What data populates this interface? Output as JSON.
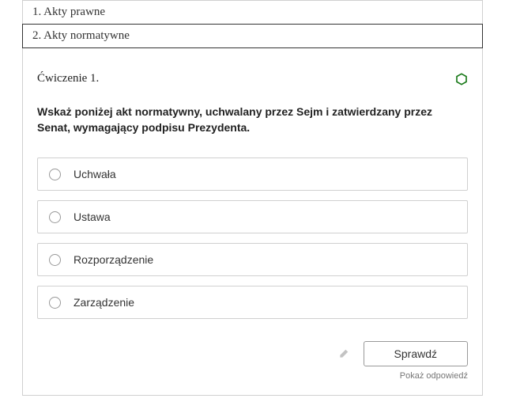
{
  "tabs": [
    {
      "label": "1. Akty prawne"
    },
    {
      "label": "2. Akty normatywne"
    }
  ],
  "exercise": {
    "title": "Ćwiczenie 1.",
    "question": "Wskaż poniżej akt normatywny, uchwalany przez Sejm i zatwierdzany przez Senat, wymagający podpisu Prezydenta.",
    "options": [
      {
        "label": "Uchwała"
      },
      {
        "label": "Ustawa"
      },
      {
        "label": "Rozporządzenie"
      },
      {
        "label": "Zarządzenie"
      }
    ],
    "check_label": "Sprawdź",
    "show_answer_label": "Pokaż odpowiedź"
  }
}
